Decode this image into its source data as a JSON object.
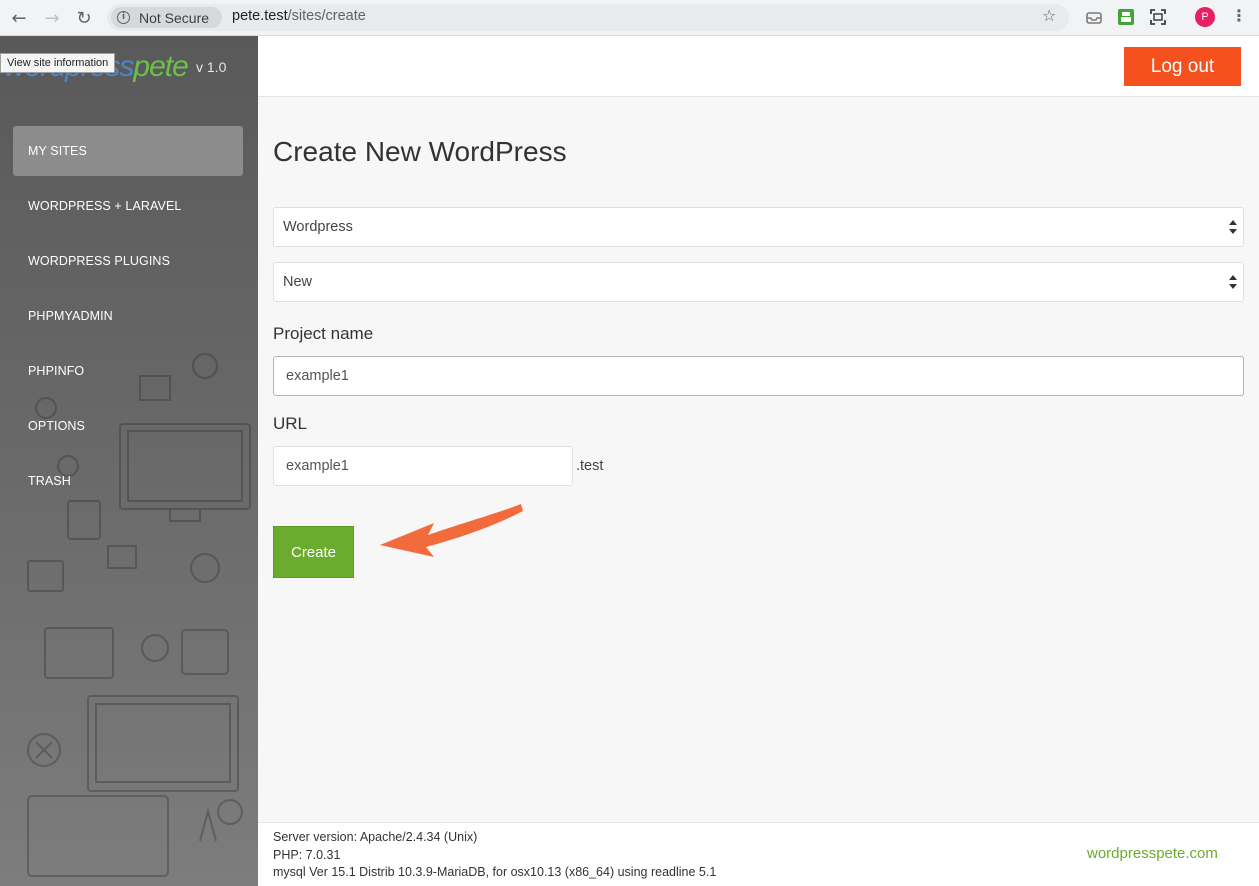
{
  "browser": {
    "security_label": "Not Secure",
    "url_host": "pete.test",
    "url_path": "/sites/create",
    "profile_initial": "P",
    "tooltip": "View site information"
  },
  "sidebar": {
    "version": "v 1.0",
    "items": [
      {
        "label": "MY SITES",
        "active": true
      },
      {
        "label": "WORDPRESS + LARAVEL"
      },
      {
        "label": "WORDPRESS PLUGINS"
      },
      {
        "label": "PHPMYADMIN"
      },
      {
        "label": "PHPINFO"
      },
      {
        "label": "OPTIONS"
      },
      {
        "label": "TRASH"
      }
    ]
  },
  "header": {
    "logout_label": "Log out"
  },
  "form": {
    "title": "Create New WordPress",
    "app_type": "Wordpress",
    "install_type": "New",
    "project_label": "Project name",
    "project_value": "example1",
    "url_label": "URL",
    "url_value": "example1",
    "url_suffix": ".test",
    "create_label": "Create"
  },
  "footer": {
    "server": "Server version: Apache/2.4.34 (Unix)",
    "php": "PHP: 7.0.31",
    "mysql": "mysql Ver 15.1 Distrib 10.3.9-MariaDB, for osx10.13 (x86_64) using readline 5.1",
    "link": "wordpresspete.com"
  },
  "colors": {
    "accent_orange": "#f4511e",
    "accent_green": "#6aac2d",
    "sidebar_bg": "#626262"
  },
  "icons": [
    "back-arrow-icon",
    "forward-arrow-icon",
    "reload-icon",
    "info-icon",
    "star-icon",
    "kebab-menu-icon",
    "select-arrows-icon",
    "annotation-arrow"
  ]
}
